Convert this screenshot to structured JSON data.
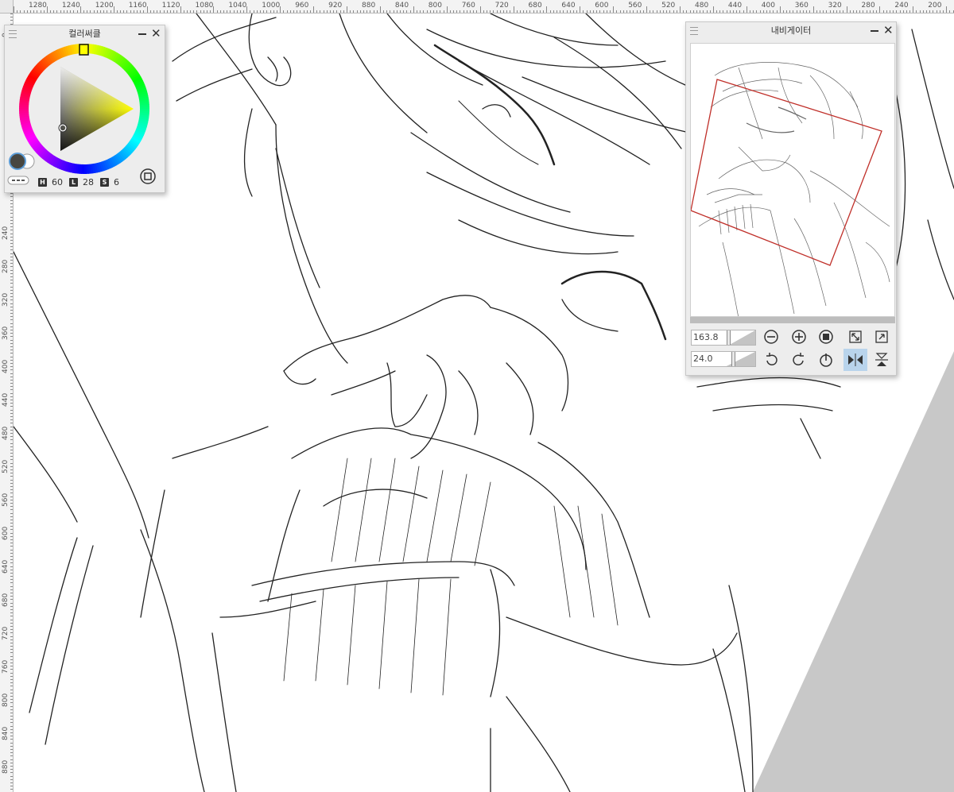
{
  "rulers": {
    "top_labels": [
      "1280",
      "1240",
      "1200",
      "1160",
      "1120",
      "1080",
      "1040",
      "1000",
      "960",
      "920",
      "880",
      "840",
      "800",
      "760",
      "720",
      "680",
      "640",
      "600",
      "560",
      "520",
      "480",
      "440",
      "400",
      "360",
      "320",
      "280",
      "240",
      "200"
    ],
    "left_labels": [
      "0",
      "240",
      "280",
      "320",
      "360",
      "400",
      "440",
      "480",
      "520",
      "560",
      "600",
      "640",
      "680",
      "720",
      "760",
      "800",
      "840",
      "880"
    ]
  },
  "color_circle": {
    "title": "컬러써클",
    "h_label": "H",
    "h_value": "60",
    "l_label": "L",
    "l_value": "28",
    "s_label": "S",
    "s_value": "6",
    "main_color": "#474640",
    "sub_color": "#ffffff"
  },
  "navigator": {
    "title": "내비게이터",
    "zoom_value": "163.8",
    "rotation_value": "24.0",
    "zoom_level": 0.55,
    "rotation_level": 0.62,
    "buttons": {
      "zoom_out": "zoom-out",
      "zoom_in": "zoom-in",
      "actual_size": "actual-size",
      "fit_screen": "fit-screen",
      "fit_width": "fit-width",
      "rotate_left": "rotate-left",
      "rotate_right": "rotate-right",
      "reset_rotation": "reset-rotation",
      "flip_horizontal": "flip-horizontal",
      "flip_vertical": "flip-vertical"
    },
    "view_frame_color": "#c0302a"
  },
  "canvas": {
    "background_shape_color": "#c8c8c8"
  }
}
